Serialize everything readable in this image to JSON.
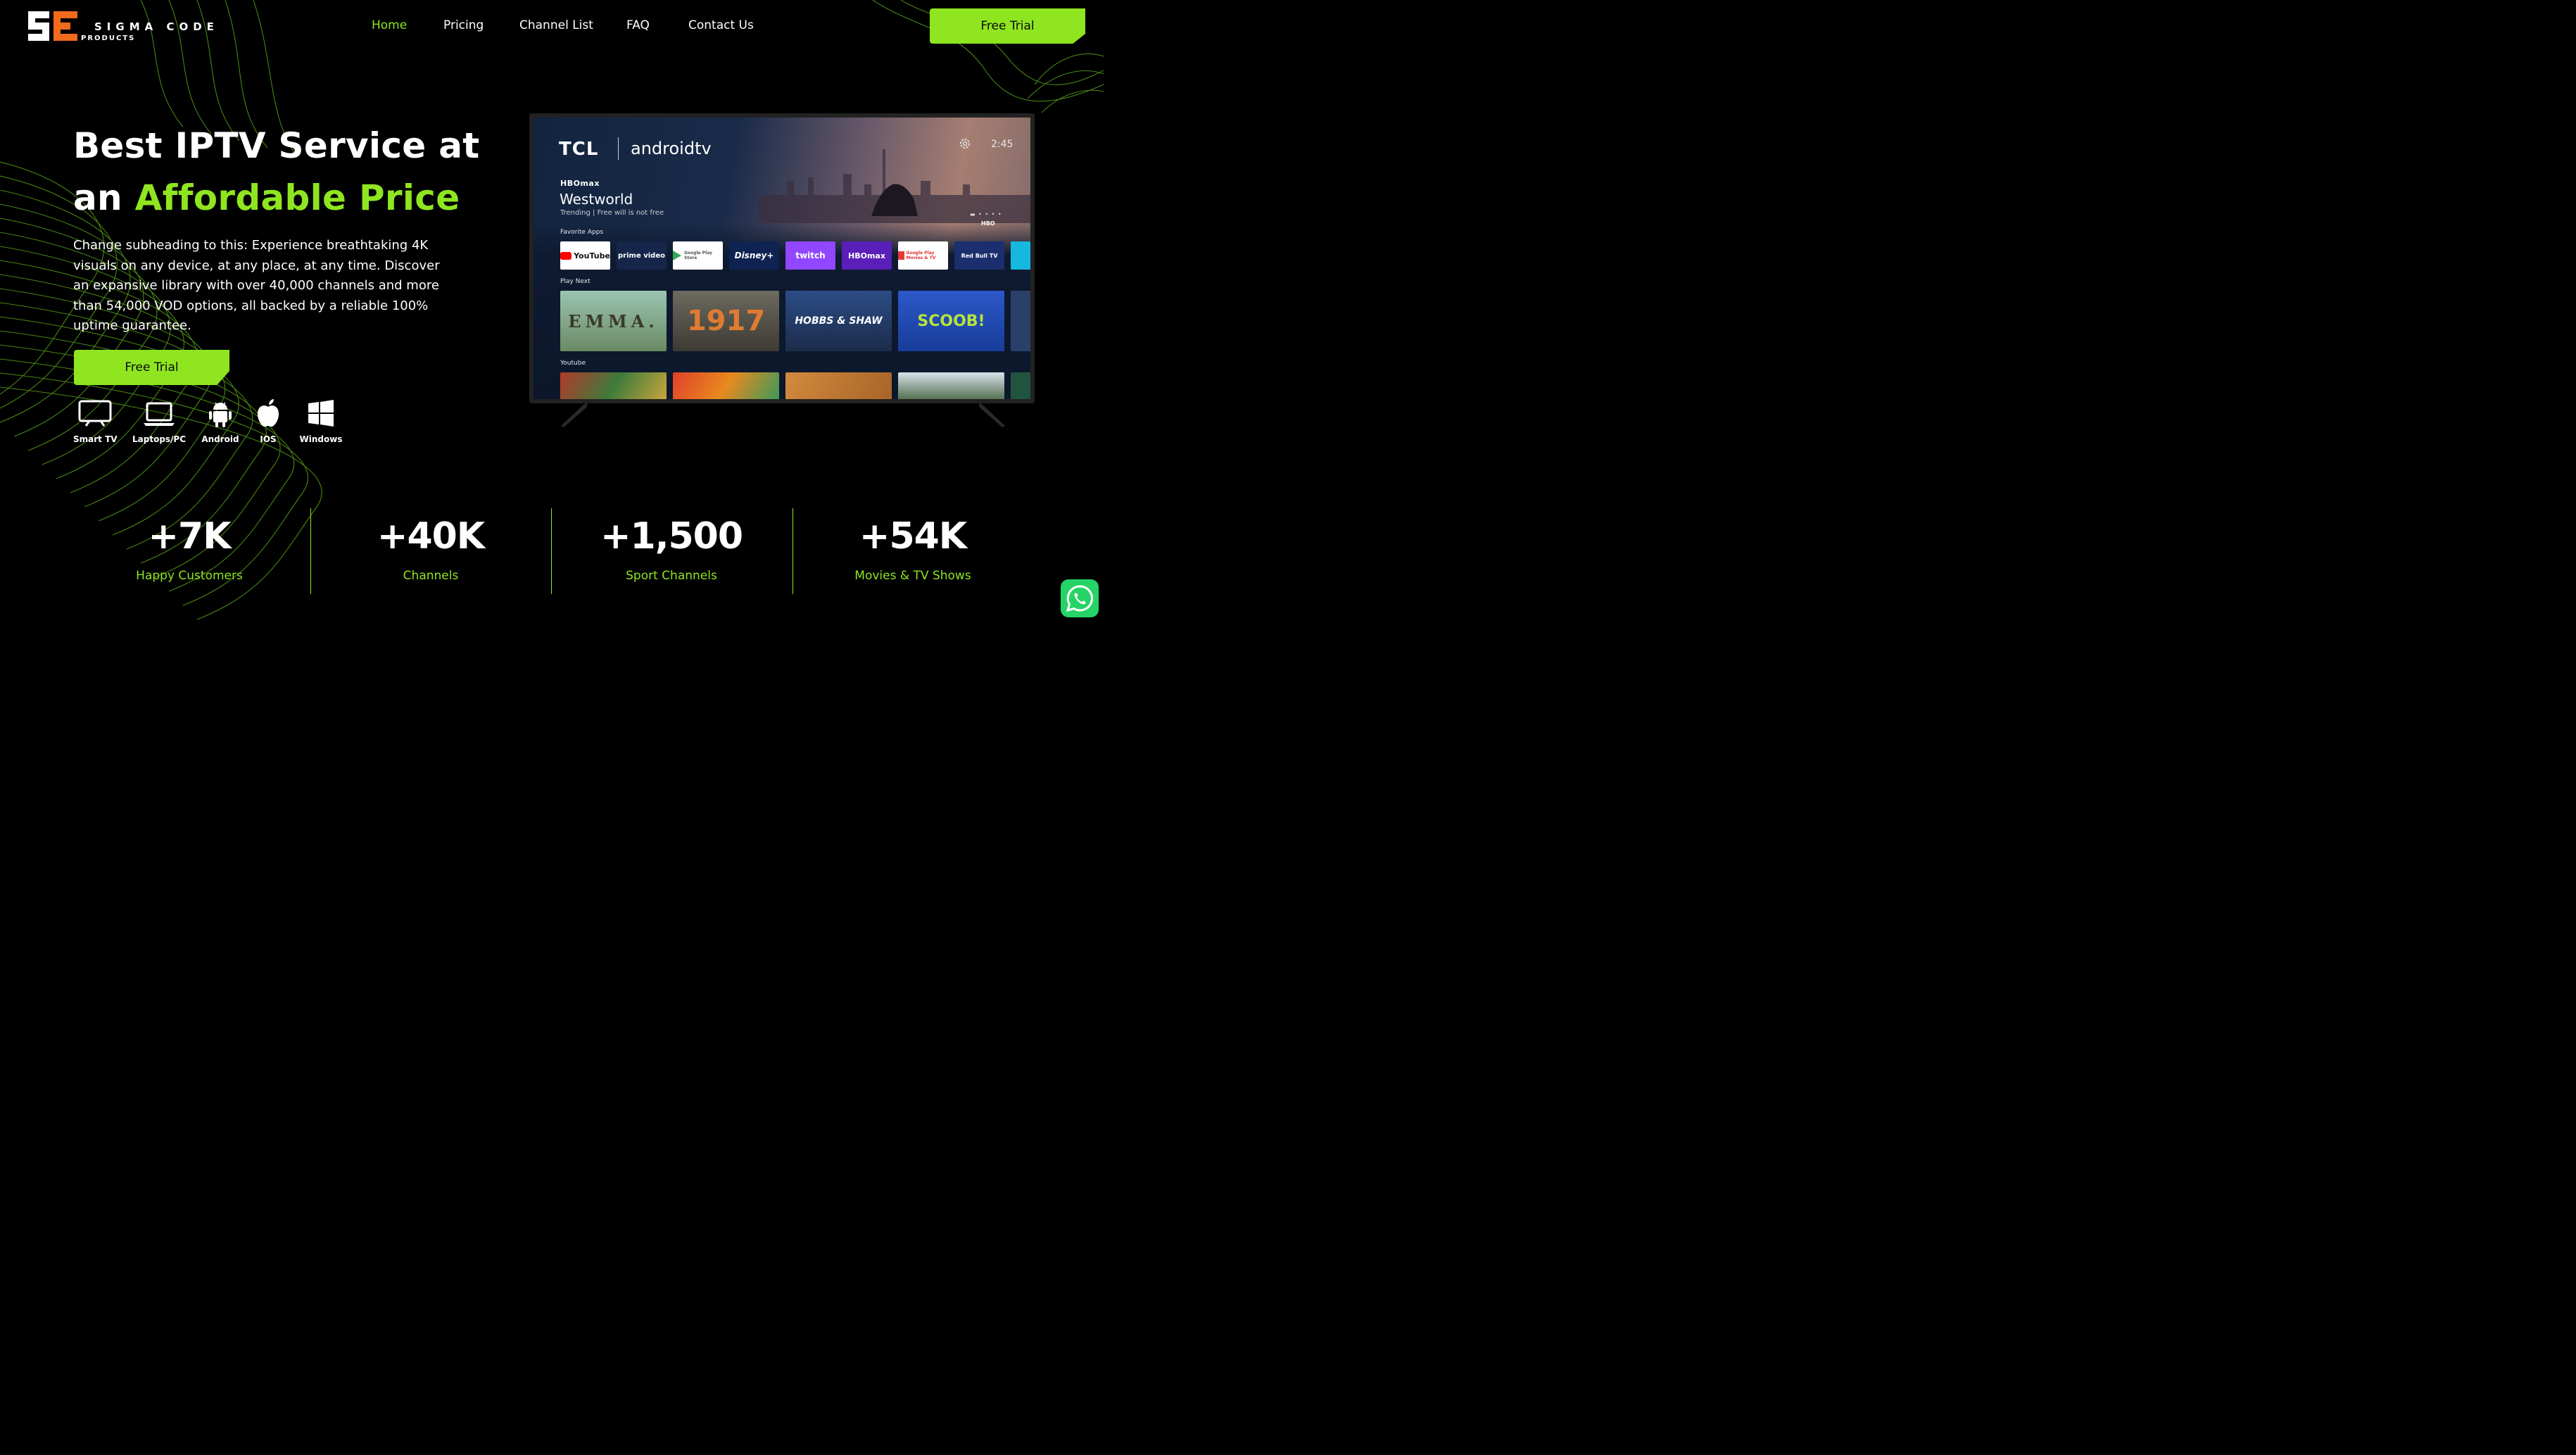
{
  "brand": {
    "name": "SIGMA CODE",
    "sub": "PRODUCTS",
    "accent": "#8fe51f",
    "logo_orange": "#f26a1b"
  },
  "nav": {
    "items": [
      "Home",
      "Pricing",
      "Channel List",
      "FAQ",
      "Contact Us"
    ],
    "active": "Home"
  },
  "header_cta": "Free Trial",
  "hero": {
    "title_line1": "Best IPTV Service at",
    "title_line2_plain": "an ",
    "title_line2_accent": "Affordable Price",
    "description": "Change subheading to this: Experience breathtaking 4K visuals on any device, at any place, at any time. Discover an expansive library with over 40,000 channels and more than 54,000 VOD options, all backed by a reliable 100% uptime guarantee.",
    "cta": "Free Trial"
  },
  "devices": [
    {
      "label": "Smart TV",
      "icon": "tv-icon"
    },
    {
      "label": "Laptops/PC",
      "icon": "laptop-icon"
    },
    {
      "label": "Android",
      "icon": "android-icon"
    },
    {
      "label": "IOS",
      "icon": "apple-icon"
    },
    {
      "label": "Windows",
      "icon": "windows-icon"
    }
  ],
  "tv": {
    "brand": "TCL",
    "platform": "androidtv",
    "time": "2:45",
    "feature_service": "HBOmax",
    "feature_title": "Westworld",
    "feature_subtitle": "Trending | Free will is not free",
    "feature_badge": "HBO",
    "favorite_apps_label": "Favorite Apps",
    "apps": [
      "YouTube",
      "prime video",
      "Google Play Store",
      "Disney+",
      "twitch",
      "HBOmax",
      "Google Play Movies & TV",
      "Red Bull TV"
    ],
    "play_next_label": "Play Next",
    "play_next": [
      "EMMA.",
      "1917",
      "HOBBS & SHAW",
      "SCOOB!"
    ],
    "youtube_label": "Youtube",
    "bezel_label": "TCL"
  },
  "stats": [
    {
      "value": "+7K",
      "label": "Happy Customers"
    },
    {
      "value": "+40K",
      "label": "Channels"
    },
    {
      "value": "+1,500",
      "label": "Sport Channels"
    },
    {
      "value": "+54K",
      "label": "Movies & TV Shows"
    }
  ],
  "whatsapp": {
    "icon": "whatsapp-icon",
    "color": "#25d366"
  }
}
